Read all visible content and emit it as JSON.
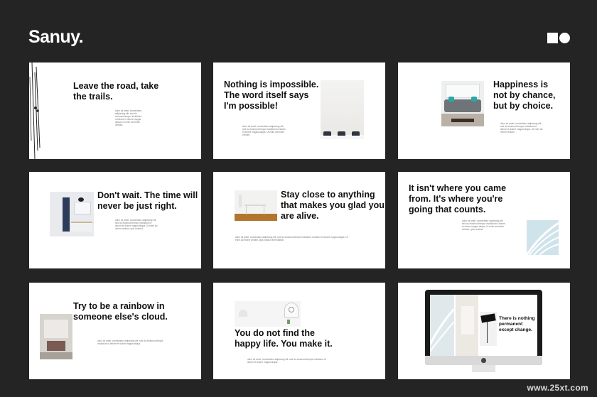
{
  "brand": {
    "name": "Sanuy."
  },
  "slides": [
    {
      "heading": "Leave the road, take the trails.",
      "body": "dolor sit amet, consectetur adipiscing elit, sed do eiusmod tempor incididunt ut labore et dolore magna aliqua. Ut enim ad minim veniam."
    },
    {
      "heading": "Nothing is impossible. The word itself says I'm possible!",
      "body": "dolor sit amet, consectetur adipiscing elit, sed do eiusmod tempor incididunt ut labore et dolore magna aliqua. Ut enim ad minim veniam."
    },
    {
      "heading": "Happiness is not by chance, but by choice.",
      "body": "dolor sit amet, consectetur adipiscing elit, sed do eiusmod tempor incididunt ut labore et dolore magna aliqua. Ut enim ad minim veniam."
    },
    {
      "heading": "Don't wait. The time will never be just right.",
      "body": "dolor sit amet, consectetur adipiscing elit, sed do eiusmod tempor incididunt ut labore et dolore magna aliqua. Ut enim ad minim veniam, quis nostrud."
    },
    {
      "heading": "Stay close to anything that makes you glad you are alive.",
      "body": "dolor sit amet, consectetur adipiscing elit, sed do eiusmod tempor incididunt ut labore et dolore magna aliqua. Ut enim ad minim veniam, quis nostrud exercitation."
    },
    {
      "heading": "It isn't where you came from. It's where you're going that counts.",
      "body": "dolor sit amet, consectetur adipiscing elit, sed do eiusmod tempor incididunt ut labore et dolore magna aliqua. Ut enim ad minim veniam, quis nostrud."
    },
    {
      "heading": "Try to be a rainbow in someone else's cloud.",
      "body": "dolor sit amet, consectetur adipiscing elit, sed do eiusmod tempor incididunt ut labore et dolore magna aliqua."
    },
    {
      "heading": "You do not find the happy life. You make it.",
      "body": "dolor sit amet, consectetur adipiscing elit, sed do eiusmod tempor incididunt ut labore et dolore magna aliqua."
    },
    {
      "heading": "There is nothing permanent except change."
    }
  ],
  "watermark": "www.25xt.com"
}
